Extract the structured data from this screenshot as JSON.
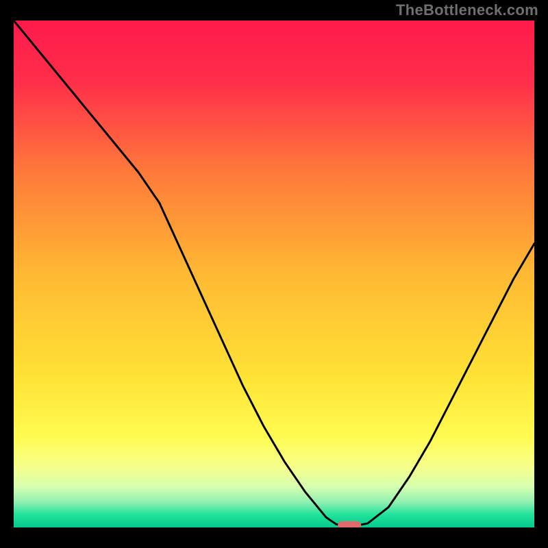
{
  "watermark_text": "TheBottleneck.com",
  "chart_data": {
    "type": "line",
    "title": "",
    "xlabel": "",
    "ylabel": "",
    "xlim": [
      0,
      100
    ],
    "ylim": [
      0,
      100
    ],
    "grid": false,
    "legend": false,
    "gradient_background": {
      "stops": [
        {
          "offset": 0.0,
          "color": "#ff1a4b"
        },
        {
          "offset": 0.12,
          "color": "#ff2e4a"
        },
        {
          "offset": 0.3,
          "color": "#ff7a3a"
        },
        {
          "offset": 0.5,
          "color": "#ffb933"
        },
        {
          "offset": 0.7,
          "color": "#ffe235"
        },
        {
          "offset": 0.82,
          "color": "#fffb50"
        },
        {
          "offset": 0.88,
          "color": "#f7ff8a"
        },
        {
          "offset": 0.92,
          "color": "#d6ffb0"
        },
        {
          "offset": 0.95,
          "color": "#8ff0b0"
        },
        {
          "offset": 0.975,
          "color": "#20e39b"
        },
        {
          "offset": 1.0,
          "color": "#05c98f"
        }
      ]
    },
    "series": [
      {
        "name": "bottleneck-curve",
        "color": "#000000",
        "x": [
          0,
          4,
          8,
          12,
          16,
          20,
          24,
          28,
          32,
          36,
          40,
          44,
          48,
          52,
          56,
          60,
          62,
          64,
          66,
          68,
          72,
          76,
          80,
          84,
          88,
          92,
          96,
          100
        ],
        "y": [
          100,
          95,
          90,
          85,
          80,
          75,
          70,
          64,
          55,
          46,
          37,
          28,
          20,
          13,
          7,
          2,
          0.6,
          0.4,
          0.4,
          0.8,
          4,
          10,
          17,
          25,
          33,
          41,
          49,
          56
        ]
      }
    ],
    "marker": {
      "x": 64.5,
      "y": 0.45,
      "width_x": 4.5,
      "height_y": 1.6,
      "color": "#e36a6a",
      "rx_frac": 0.6
    }
  }
}
